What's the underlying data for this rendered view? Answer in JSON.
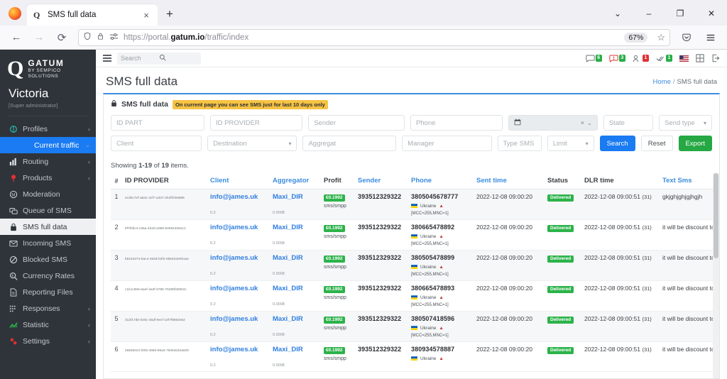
{
  "browser": {
    "tab_title": "SMS full data",
    "tab_favicon": "gatum-icon",
    "close_tab": "×",
    "new_tab": "+",
    "back": "←",
    "forward": "→",
    "reload": "⟳",
    "url_scheme": "https://portal.",
    "url_domain": "gatum.io",
    "url_path": "/traffic/index",
    "zoom_level": "67%",
    "bookmark": "☆",
    "list_all_tabs": "⌄",
    "minimize": "–",
    "maximize": "❐",
    "close": "✕",
    "shield": "shield-icon",
    "lock": "lock-icon",
    "reader": "reader-icon",
    "save_to_pocket": "pocket-icon",
    "app_menu": "hamburger-icon"
  },
  "sidebar": {
    "brand_name": "GATUM",
    "brand_sub": "BY SEMPICO SOLUTIONS",
    "user_name": "Victoria",
    "user_role": "[Super administrator]",
    "items": [
      {
        "label": "Profiles",
        "icon": "profiles-icon",
        "caret": "‹",
        "state": "normal"
      },
      {
        "label": "Current traffic",
        "icon": "",
        "caret": "⌄",
        "state": "active"
      },
      {
        "label": "Routing",
        "icon": "routing-icon",
        "caret": "‹",
        "state": "normal"
      },
      {
        "label": "Products",
        "icon": "products-icon",
        "caret": "‹",
        "state": "normal"
      },
      {
        "label": "Moderation",
        "icon": "moderation-icon",
        "caret": "",
        "state": "normal"
      },
      {
        "label": "Queue of SMS",
        "icon": "queue-icon",
        "caret": "",
        "state": "normal"
      },
      {
        "label": "SMS full data",
        "icon": "sms-full-data-icon",
        "caret": "",
        "state": "selected"
      },
      {
        "label": "Incoming SMS",
        "icon": "incoming-sms-icon",
        "caret": "",
        "state": "normal"
      },
      {
        "label": "Blocked SMS",
        "icon": "blocked-sms-icon",
        "caret": "",
        "state": "normal"
      },
      {
        "label": "Currency Rates",
        "icon": "currency-icon",
        "caret": "",
        "state": "normal"
      },
      {
        "label": "Reporting Files",
        "icon": "reporting-icon",
        "caret": "",
        "state": "normal"
      },
      {
        "label": "Responses",
        "icon": "responses-icon",
        "caret": "‹",
        "state": "normal"
      },
      {
        "label": "Statistic",
        "icon": "statistic-icon",
        "caret": "‹",
        "state": "normal"
      },
      {
        "label": "Settings",
        "icon": "settings-icon",
        "caret": "‹",
        "state": "normal"
      }
    ]
  },
  "topbar": {
    "menu_toggle": "hamburger-icon",
    "search_placeholder": "Search",
    "search_icon": "search-icon",
    "icons": [
      {
        "name": "sms-icon",
        "count": "6",
        "badge_color": "#27ae45"
      },
      {
        "name": "alert-icon",
        "count": "3",
        "badge_color": "#27ae45"
      },
      {
        "name": "users-icon",
        "count": "1",
        "badge_color": "#e03131"
      },
      {
        "name": "checks-icon",
        "count": "1",
        "badge_color": "#27ae45"
      }
    ],
    "language_flag": "us-flag-icon",
    "grid_icon": "grid-icon",
    "logout_icon": "logout-icon"
  },
  "page": {
    "title": "SMS full data",
    "breadcrumb_home": "Home",
    "breadcrumb_sep": "/",
    "breadcrumb_current": "SMS full data"
  },
  "panel": {
    "lock_icon": "lock-icon",
    "title": "SMS full data",
    "warning": "On current page you can see SMS just for last 10 days only"
  },
  "filters": {
    "id_part": "ID PART",
    "id_provider": "ID PROVIDER",
    "sender": "Sender",
    "phone": "Phone",
    "date_icon": "calendar-icon",
    "date_clear": "×",
    "date_caret": "⌄",
    "state": "State",
    "send_type": "Send type",
    "client": "Client",
    "destination": "Destination",
    "aggregat": "Aggregat",
    "manager": "Manager",
    "type_sms": "Type SMS",
    "limit": "Limit",
    "search_button": "Search",
    "reset_button": "Reset",
    "export_button": "Export"
  },
  "table": {
    "showing_prefix": "Showing",
    "showing_range": "1-19",
    "showing_of": "of",
    "showing_total": "19",
    "showing_suffix": "items.",
    "columns": [
      {
        "label": "#",
        "link": false
      },
      {
        "label": "ID PROVIDER",
        "link": false
      },
      {
        "label": "Client",
        "link": true
      },
      {
        "label": "Aggregator",
        "link": true
      },
      {
        "label": "Profit",
        "link": false
      },
      {
        "label": "Sender",
        "link": true
      },
      {
        "label": "Phone",
        "link": true
      },
      {
        "label": "Sent time",
        "link": true
      },
      {
        "label": "Status",
        "link": false
      },
      {
        "label": "DLR time",
        "link": false
      },
      {
        "label": "Text Sms",
        "link": true
      },
      {
        "label": "",
        "link": false
      }
    ],
    "rows": [
      {
        "idx": "1",
        "id_provider": "ec3bc7ef-a631-4cf7-a337-2b1ffcfe6895",
        "client": "info@james.uk",
        "client_rate": "0.2",
        "aggregator": "Maxi_DIR",
        "aggregator_rate": "0.0008",
        "profit": "€0.1992",
        "profit_type": "sms/smpp",
        "sender": "393512329322",
        "phone": "3805045678777",
        "country": "Ukraine",
        "mcc": "[MCC=255,MNC=1]",
        "sent_time": "2022-12-08 09:00:20",
        "status": "Delivered",
        "dlr_time": "2022-12-08 09:00:51",
        "dlr_suffix": "(31)",
        "text": "gkjghjghjgjhgjh",
        "action": "view-icon"
      },
      {
        "idx": "2",
        "id_provider": "9f7bfdc4-c65a-4b2d-a089-92694405e12",
        "client": "info@james.uk",
        "client_rate": "0.2",
        "aggregator": "Maxi_DIR",
        "aggregator_rate": "0.0008",
        "profit": "€0.1992",
        "profit_type": "sms/smpp",
        "sender": "393512329322",
        "phone": "380665478892",
        "country": "Ukraine",
        "mcc": "[MCC=255,MNC=1]",
        "sent_time": "2022-12-08 09:00:20",
        "status": "Delivered",
        "dlr_time": "2022-12-08 09:00:51",
        "dlr_suffix": "(31)",
        "text": "it will be discount today!",
        "action": "view-icon"
      },
      {
        "idx": "3",
        "id_provider": "b6154274-5ac4-463d-b2f4-655404e051ae",
        "client": "info@james.uk",
        "client_rate": "0.2",
        "aggregator": "Maxi_DIR",
        "aggregator_rate": "0.0008",
        "profit": "€0.1992",
        "profit_type": "sms/smpp",
        "sender": "393512329322",
        "phone": "380505478899",
        "country": "Ukraine",
        "mcc": "[MCC=255,MNC=1]",
        "sent_time": "2022-12-08 09:00:20",
        "status": "Delivered",
        "dlr_time": "2022-12-08 09:00:51",
        "dlr_suffix": "(31)",
        "text": "it will be discount today!",
        "action": "view-icon"
      },
      {
        "idx": "4",
        "id_provider": "c1b1c856-6aef-4a3f-979b-75299f2b904c",
        "client": "info@james.uk",
        "client_rate": "0.2",
        "aggregator": "Maxi_DIR",
        "aggregator_rate": "0.0008",
        "profit": "€0.1992",
        "profit_type": "sms/smpp",
        "sender": "393512329322",
        "phone": "380665478893",
        "country": "Ukraine",
        "mcc": "[MCC=255,MNC=1]",
        "sent_time": "2022-12-08 09:00:20",
        "status": "Delivered",
        "dlr_time": "2022-12-08 09:00:51",
        "dlr_suffix": "(31)",
        "text": "it will be discount today!",
        "action": "view-icon"
      },
      {
        "idx": "5",
        "id_provider": "312f17d6-0201-46df-9ecf-15f7f9883e52",
        "client": "info@james.uk",
        "client_rate": "0.2",
        "aggregator": "Maxi_DIR",
        "aggregator_rate": "0.0008",
        "profit": "€0.1992",
        "profit_type": "sms/smpp",
        "sender": "393512329322",
        "phone": "380507418596",
        "country": "Ukraine",
        "mcc": "[MCC=255,MNC=1]",
        "sent_time": "2022-12-08 09:00:20",
        "status": "Delivered",
        "dlr_time": "2022-12-08 09:00:51",
        "dlr_suffix": "(31)",
        "text": "it will be discount today!",
        "action": "view-icon"
      },
      {
        "idx": "6",
        "id_provider": "265850c0-f209-499d-85a3-7505eb34a929",
        "client": "info@james.uk",
        "client_rate": "0.2",
        "aggregator": "Maxi_DIR",
        "aggregator_rate": "0.0008",
        "profit": "€0.1992",
        "profit_type": "sms/smpp",
        "sender": "393512329322",
        "phone": "380934578887",
        "country": "Ukraine",
        "mcc": "",
        "sent_time": "2022-12-08 09:00:20",
        "status": "Delivered",
        "dlr_time": "2022-12-08 09:00:51",
        "dlr_suffix": "(31)",
        "text": "it will be discount today!",
        "action": "view-icon"
      }
    ]
  },
  "colors": {
    "accent_blue": "#1a7bf2",
    "link_blue": "#3c8dde",
    "success_green": "#2cb34a",
    "warning_yellow": "#f6c343",
    "danger_red": "#e03131",
    "sidebar_bg": "#2f343a",
    "highlight_border": "#ea2020"
  }
}
